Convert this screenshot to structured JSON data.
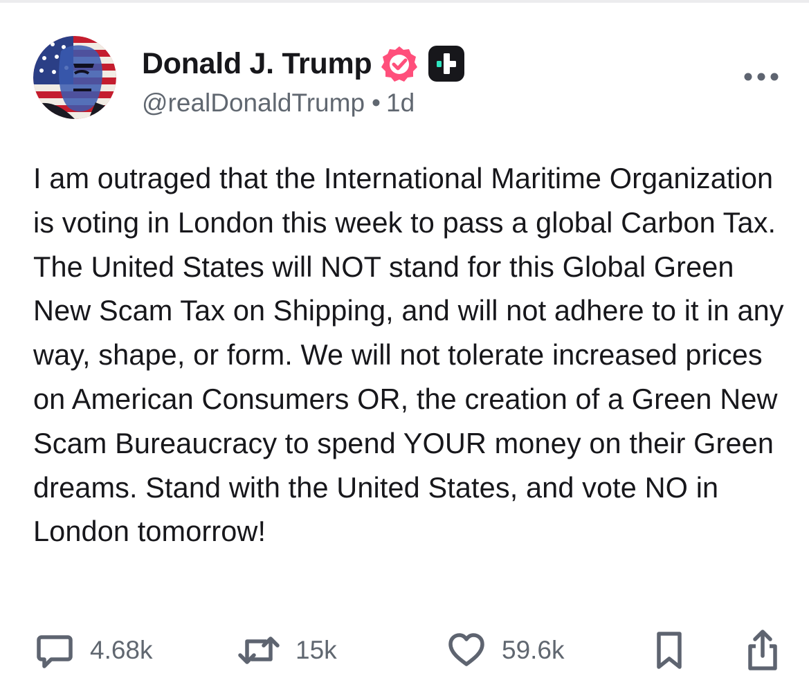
{
  "post": {
    "author": {
      "display_name": "Donald J. Trump",
      "handle": "@realDonaldTrump",
      "separator": "•",
      "time": "1d",
      "verified_badge_icon": "verified-check-icon",
      "verified_badge_color": "#ff4f7b",
      "plus_badge_icon": "plus-icon",
      "plus_badge_color": "#17171b",
      "plus_badge_accent": "#2ee6c0"
    },
    "more_icon": "ellipsis-icon",
    "text": "I am outraged that the International Maritime Organization is voting in London this week to pass a global Carbon Tax. The United States will NOT stand for this Global Green New Scam Tax on Shipping, and will not adhere to it in any way, shape, or form. We will not tolerate increased prices on American Consumers OR, the creation of a Green New Scam Bureaucracy to spend YOUR money on their Green dreams. Stand with the United States, and vote NO in London tomorrow!"
  },
  "actions": {
    "replies": {
      "icon": "reply-icon",
      "count": "4.68k"
    },
    "reposts": {
      "icon": "repost-icon",
      "count": "15k"
    },
    "likes": {
      "icon": "heart-icon",
      "count": "59.6k"
    },
    "bookmark": {
      "icon": "bookmark-icon"
    },
    "share": {
      "icon": "share-icon"
    }
  },
  "colors": {
    "text": "#17171b",
    "muted": "#606770",
    "icon": "#5e6470"
  }
}
